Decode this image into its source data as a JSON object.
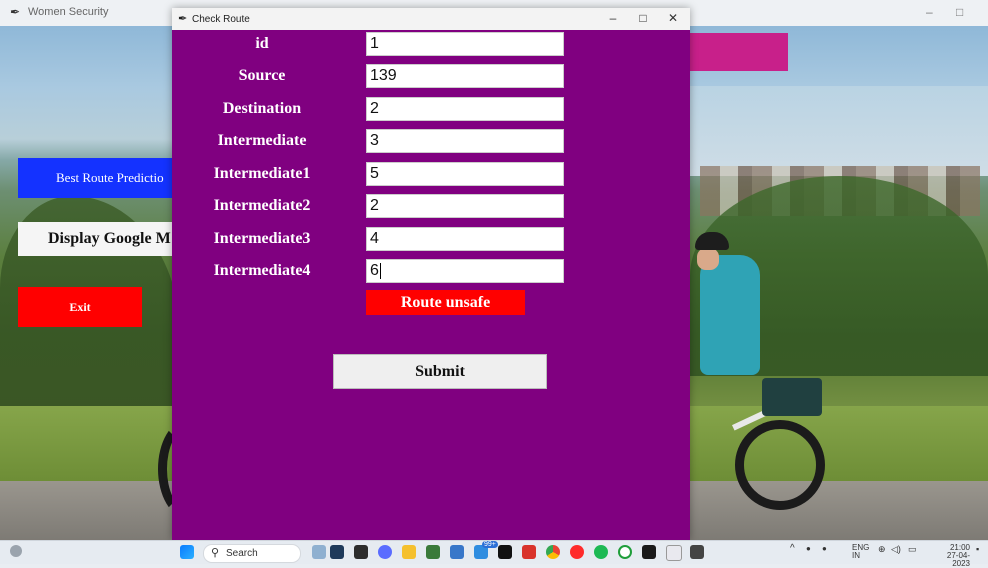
{
  "background_window": {
    "title": "Women Security",
    "controls": {
      "minimize": "–",
      "maximize": "□"
    },
    "buttons": {
      "best_route": "Best Route Predictio",
      "display_google": "Display Google M",
      "exit": "Exit"
    }
  },
  "dialog": {
    "title": "Check Route",
    "controls": {
      "minimize": "–",
      "maximize": "□",
      "close": "✕"
    },
    "fields": [
      {
        "label": "id",
        "value": "1"
      },
      {
        "label": "Source",
        "value": "139"
      },
      {
        "label": "Destination",
        "value": "2"
      },
      {
        "label": "Intermediate",
        "value": "3"
      },
      {
        "label": "Intermediate1",
        "value": "5"
      },
      {
        "label": "Intermediate2",
        "value": "2"
      },
      {
        "label": "Intermediate3",
        "value": "4"
      },
      {
        "label": "Intermediate4",
        "value": "6"
      }
    ],
    "result": "Route unsafe",
    "submit": "Submit"
  },
  "taskbar": {
    "search_placeholder": "Search",
    "badge": "99+",
    "lang": "ENG",
    "region": "IN",
    "time": "21:00",
    "date": "27-04-2023"
  },
  "colors": {
    "dialog_bg": "#800080",
    "result_bg": "#ff0000",
    "route_btn": "#1432ff",
    "exit_btn": "#ff0000",
    "pink_box": "#c8208a"
  }
}
